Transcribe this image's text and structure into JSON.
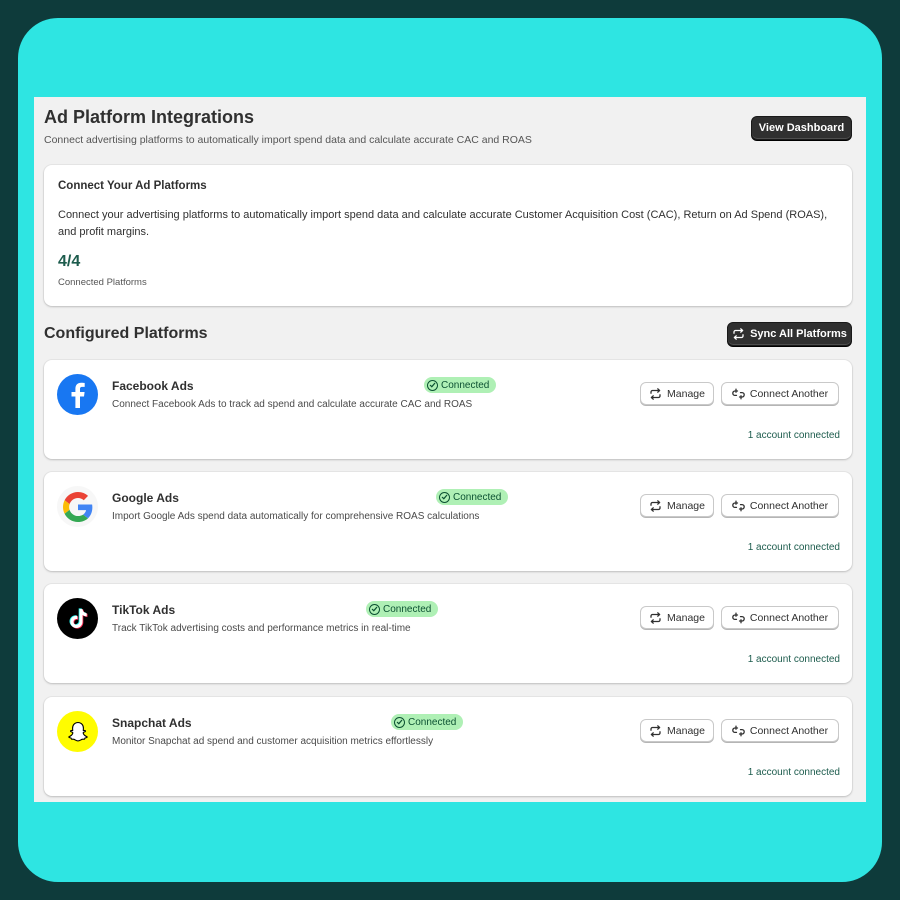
{
  "page": {
    "title": "Ad Platform Integrations",
    "subtitle": "Connect advertising platforms to automatically import spend data and calculate accurate CAC and ROAS",
    "view_dashboard_label": "View Dashboard"
  },
  "summary": {
    "title": "Connect Your Ad Platforms",
    "text": "Connect your advertising platforms to automatically import spend data and calculate accurate Customer Acquisition Cost (CAC), Return on Ad Spend (ROAS), and profit margins.",
    "count": "4/4",
    "count_label": "Connected Platforms"
  },
  "configured": {
    "title": "Configured Platforms",
    "sync_all_label": "Sync All Platforms"
  },
  "platforms": [
    {
      "name": "Facebook Ads",
      "description": "Connect Facebook Ads to track ad spend and calculate accurate CAC and ROAS",
      "status": "Connected",
      "manage_label": "Manage",
      "connect_another_label": "Connect Another",
      "accounts_text": "1 account connected",
      "icon": "facebook-icon",
      "brand_color": "#1877f2"
    },
    {
      "name": "Google Ads",
      "description": "Import Google Ads spend data automatically for comprehensive ROAS calculations",
      "status": "Connected",
      "manage_label": "Manage",
      "connect_another_label": "Connect Another",
      "accounts_text": "1 account connected",
      "icon": "google-icon",
      "brand_color": "#4285f4"
    },
    {
      "name": "TikTok Ads",
      "description": "Track TikTok advertising costs and performance metrics in real-time",
      "status": "Connected",
      "manage_label": "Manage",
      "connect_another_label": "Connect Another",
      "accounts_text": "1 account connected",
      "icon": "tiktok-icon",
      "brand_color": "#000000"
    },
    {
      "name": "Snapchat Ads",
      "description": "Monitor Snapchat ad spend and customer acquisition metrics effortlessly",
      "status": "Connected",
      "manage_label": "Manage",
      "connect_another_label": "Connect Another",
      "accounts_text": "1 account connected",
      "icon": "snapchat-icon",
      "brand_color": "#fffc00"
    }
  ],
  "colors": {
    "status_badge_bg": "#aff0b5",
    "status_badge_text": "#0c5132",
    "accent_text": "#1d5c4d",
    "primary_button": "#303030"
  }
}
